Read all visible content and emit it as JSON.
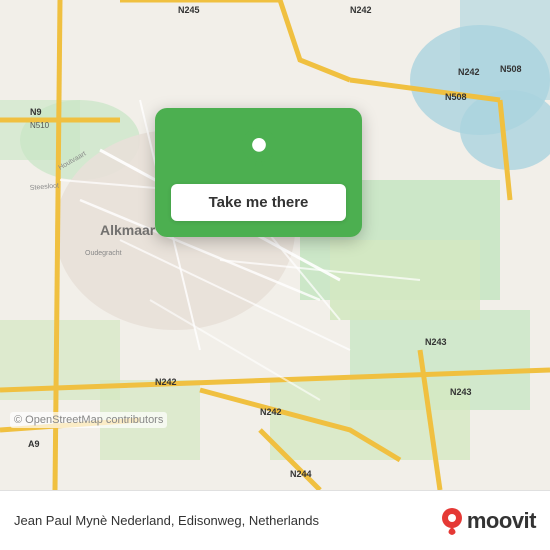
{
  "map": {
    "alt": "Map of Alkmaar, Netherlands area",
    "copyright": "© OpenStreetMap contributors"
  },
  "popup": {
    "button_label": "Take me there",
    "pin_icon": "location-pin"
  },
  "bottom_bar": {
    "location_text": "Jean Paul Mynè Nederland, Edisonweg, Netherlands",
    "brand_name": "moovit",
    "pin_icon": "location-pin-red"
  }
}
